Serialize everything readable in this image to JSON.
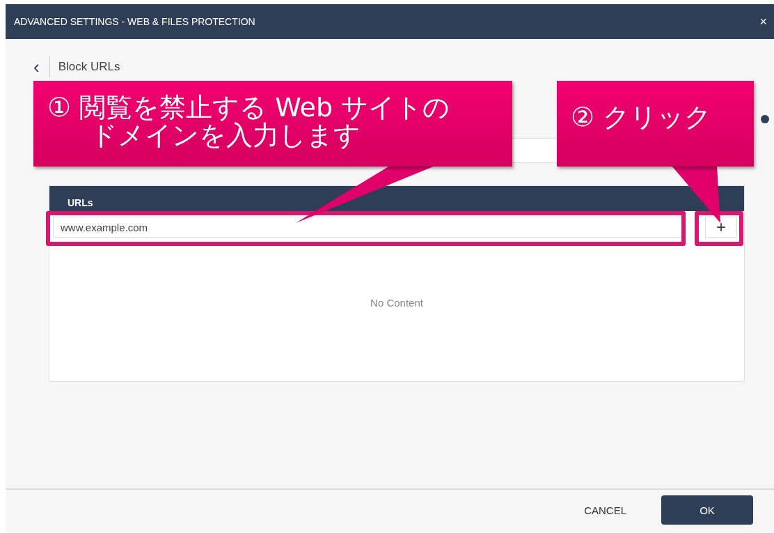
{
  "window": {
    "title": "ADVANCED SETTINGS - WEB & FILES PROTECTION",
    "close": "×"
  },
  "page": {
    "back": "‹",
    "title": "Block URLs"
  },
  "table": {
    "column": "URLs",
    "input_value": "www.example.com",
    "add": "+",
    "empty": "No Content"
  },
  "buttons": {
    "cancel": "CANCEL",
    "ok": "OK"
  },
  "annotations": [
    {
      "lines": [
        "① 閲覧を禁止する Web サイトの",
        "ドメインを入力します"
      ]
    },
    {
      "lines": [
        "② クリック"
      ]
    }
  ]
}
